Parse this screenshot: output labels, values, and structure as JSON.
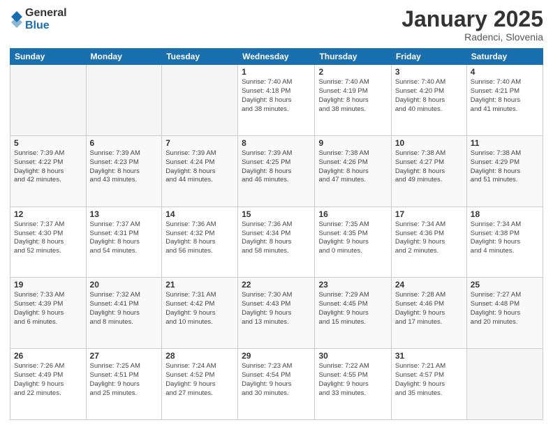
{
  "header": {
    "logo_general": "General",
    "logo_blue": "Blue",
    "month_title": "January 2025",
    "location": "Radenci, Slovenia"
  },
  "weekdays": [
    "Sunday",
    "Monday",
    "Tuesday",
    "Wednesday",
    "Thursday",
    "Friday",
    "Saturday"
  ],
  "weeks": [
    [
      {
        "day": "",
        "info": ""
      },
      {
        "day": "",
        "info": ""
      },
      {
        "day": "",
        "info": ""
      },
      {
        "day": "1",
        "info": "Sunrise: 7:40 AM\nSunset: 4:18 PM\nDaylight: 8 hours\nand 38 minutes."
      },
      {
        "day": "2",
        "info": "Sunrise: 7:40 AM\nSunset: 4:19 PM\nDaylight: 8 hours\nand 38 minutes."
      },
      {
        "day": "3",
        "info": "Sunrise: 7:40 AM\nSunset: 4:20 PM\nDaylight: 8 hours\nand 40 minutes."
      },
      {
        "day": "4",
        "info": "Sunrise: 7:40 AM\nSunset: 4:21 PM\nDaylight: 8 hours\nand 41 minutes."
      }
    ],
    [
      {
        "day": "5",
        "info": "Sunrise: 7:39 AM\nSunset: 4:22 PM\nDaylight: 8 hours\nand 42 minutes."
      },
      {
        "day": "6",
        "info": "Sunrise: 7:39 AM\nSunset: 4:23 PM\nDaylight: 8 hours\nand 43 minutes."
      },
      {
        "day": "7",
        "info": "Sunrise: 7:39 AM\nSunset: 4:24 PM\nDaylight: 8 hours\nand 44 minutes."
      },
      {
        "day": "8",
        "info": "Sunrise: 7:39 AM\nSunset: 4:25 PM\nDaylight: 8 hours\nand 46 minutes."
      },
      {
        "day": "9",
        "info": "Sunrise: 7:38 AM\nSunset: 4:26 PM\nDaylight: 8 hours\nand 47 minutes."
      },
      {
        "day": "10",
        "info": "Sunrise: 7:38 AM\nSunset: 4:27 PM\nDaylight: 8 hours\nand 49 minutes."
      },
      {
        "day": "11",
        "info": "Sunrise: 7:38 AM\nSunset: 4:29 PM\nDaylight: 8 hours\nand 51 minutes."
      }
    ],
    [
      {
        "day": "12",
        "info": "Sunrise: 7:37 AM\nSunset: 4:30 PM\nDaylight: 8 hours\nand 52 minutes."
      },
      {
        "day": "13",
        "info": "Sunrise: 7:37 AM\nSunset: 4:31 PM\nDaylight: 8 hours\nand 54 minutes."
      },
      {
        "day": "14",
        "info": "Sunrise: 7:36 AM\nSunset: 4:32 PM\nDaylight: 8 hours\nand 56 minutes."
      },
      {
        "day": "15",
        "info": "Sunrise: 7:36 AM\nSunset: 4:34 PM\nDaylight: 8 hours\nand 58 minutes."
      },
      {
        "day": "16",
        "info": "Sunrise: 7:35 AM\nSunset: 4:35 PM\nDaylight: 9 hours\nand 0 minutes."
      },
      {
        "day": "17",
        "info": "Sunrise: 7:34 AM\nSunset: 4:36 PM\nDaylight: 9 hours\nand 2 minutes."
      },
      {
        "day": "18",
        "info": "Sunrise: 7:34 AM\nSunset: 4:38 PM\nDaylight: 9 hours\nand 4 minutes."
      }
    ],
    [
      {
        "day": "19",
        "info": "Sunrise: 7:33 AM\nSunset: 4:39 PM\nDaylight: 9 hours\nand 6 minutes."
      },
      {
        "day": "20",
        "info": "Sunrise: 7:32 AM\nSunset: 4:41 PM\nDaylight: 9 hours\nand 8 minutes."
      },
      {
        "day": "21",
        "info": "Sunrise: 7:31 AM\nSunset: 4:42 PM\nDaylight: 9 hours\nand 10 minutes."
      },
      {
        "day": "22",
        "info": "Sunrise: 7:30 AM\nSunset: 4:43 PM\nDaylight: 9 hours\nand 13 minutes."
      },
      {
        "day": "23",
        "info": "Sunrise: 7:29 AM\nSunset: 4:45 PM\nDaylight: 9 hours\nand 15 minutes."
      },
      {
        "day": "24",
        "info": "Sunrise: 7:28 AM\nSunset: 4:46 PM\nDaylight: 9 hours\nand 17 minutes."
      },
      {
        "day": "25",
        "info": "Sunrise: 7:27 AM\nSunset: 4:48 PM\nDaylight: 9 hours\nand 20 minutes."
      }
    ],
    [
      {
        "day": "26",
        "info": "Sunrise: 7:26 AM\nSunset: 4:49 PM\nDaylight: 9 hours\nand 22 minutes."
      },
      {
        "day": "27",
        "info": "Sunrise: 7:25 AM\nSunset: 4:51 PM\nDaylight: 9 hours\nand 25 minutes."
      },
      {
        "day": "28",
        "info": "Sunrise: 7:24 AM\nSunset: 4:52 PM\nDaylight: 9 hours\nand 27 minutes."
      },
      {
        "day": "29",
        "info": "Sunrise: 7:23 AM\nSunset: 4:54 PM\nDaylight: 9 hours\nand 30 minutes."
      },
      {
        "day": "30",
        "info": "Sunrise: 7:22 AM\nSunset: 4:55 PM\nDaylight: 9 hours\nand 33 minutes."
      },
      {
        "day": "31",
        "info": "Sunrise: 7:21 AM\nSunset: 4:57 PM\nDaylight: 9 hours\nand 35 minutes."
      },
      {
        "day": "",
        "info": ""
      }
    ]
  ]
}
